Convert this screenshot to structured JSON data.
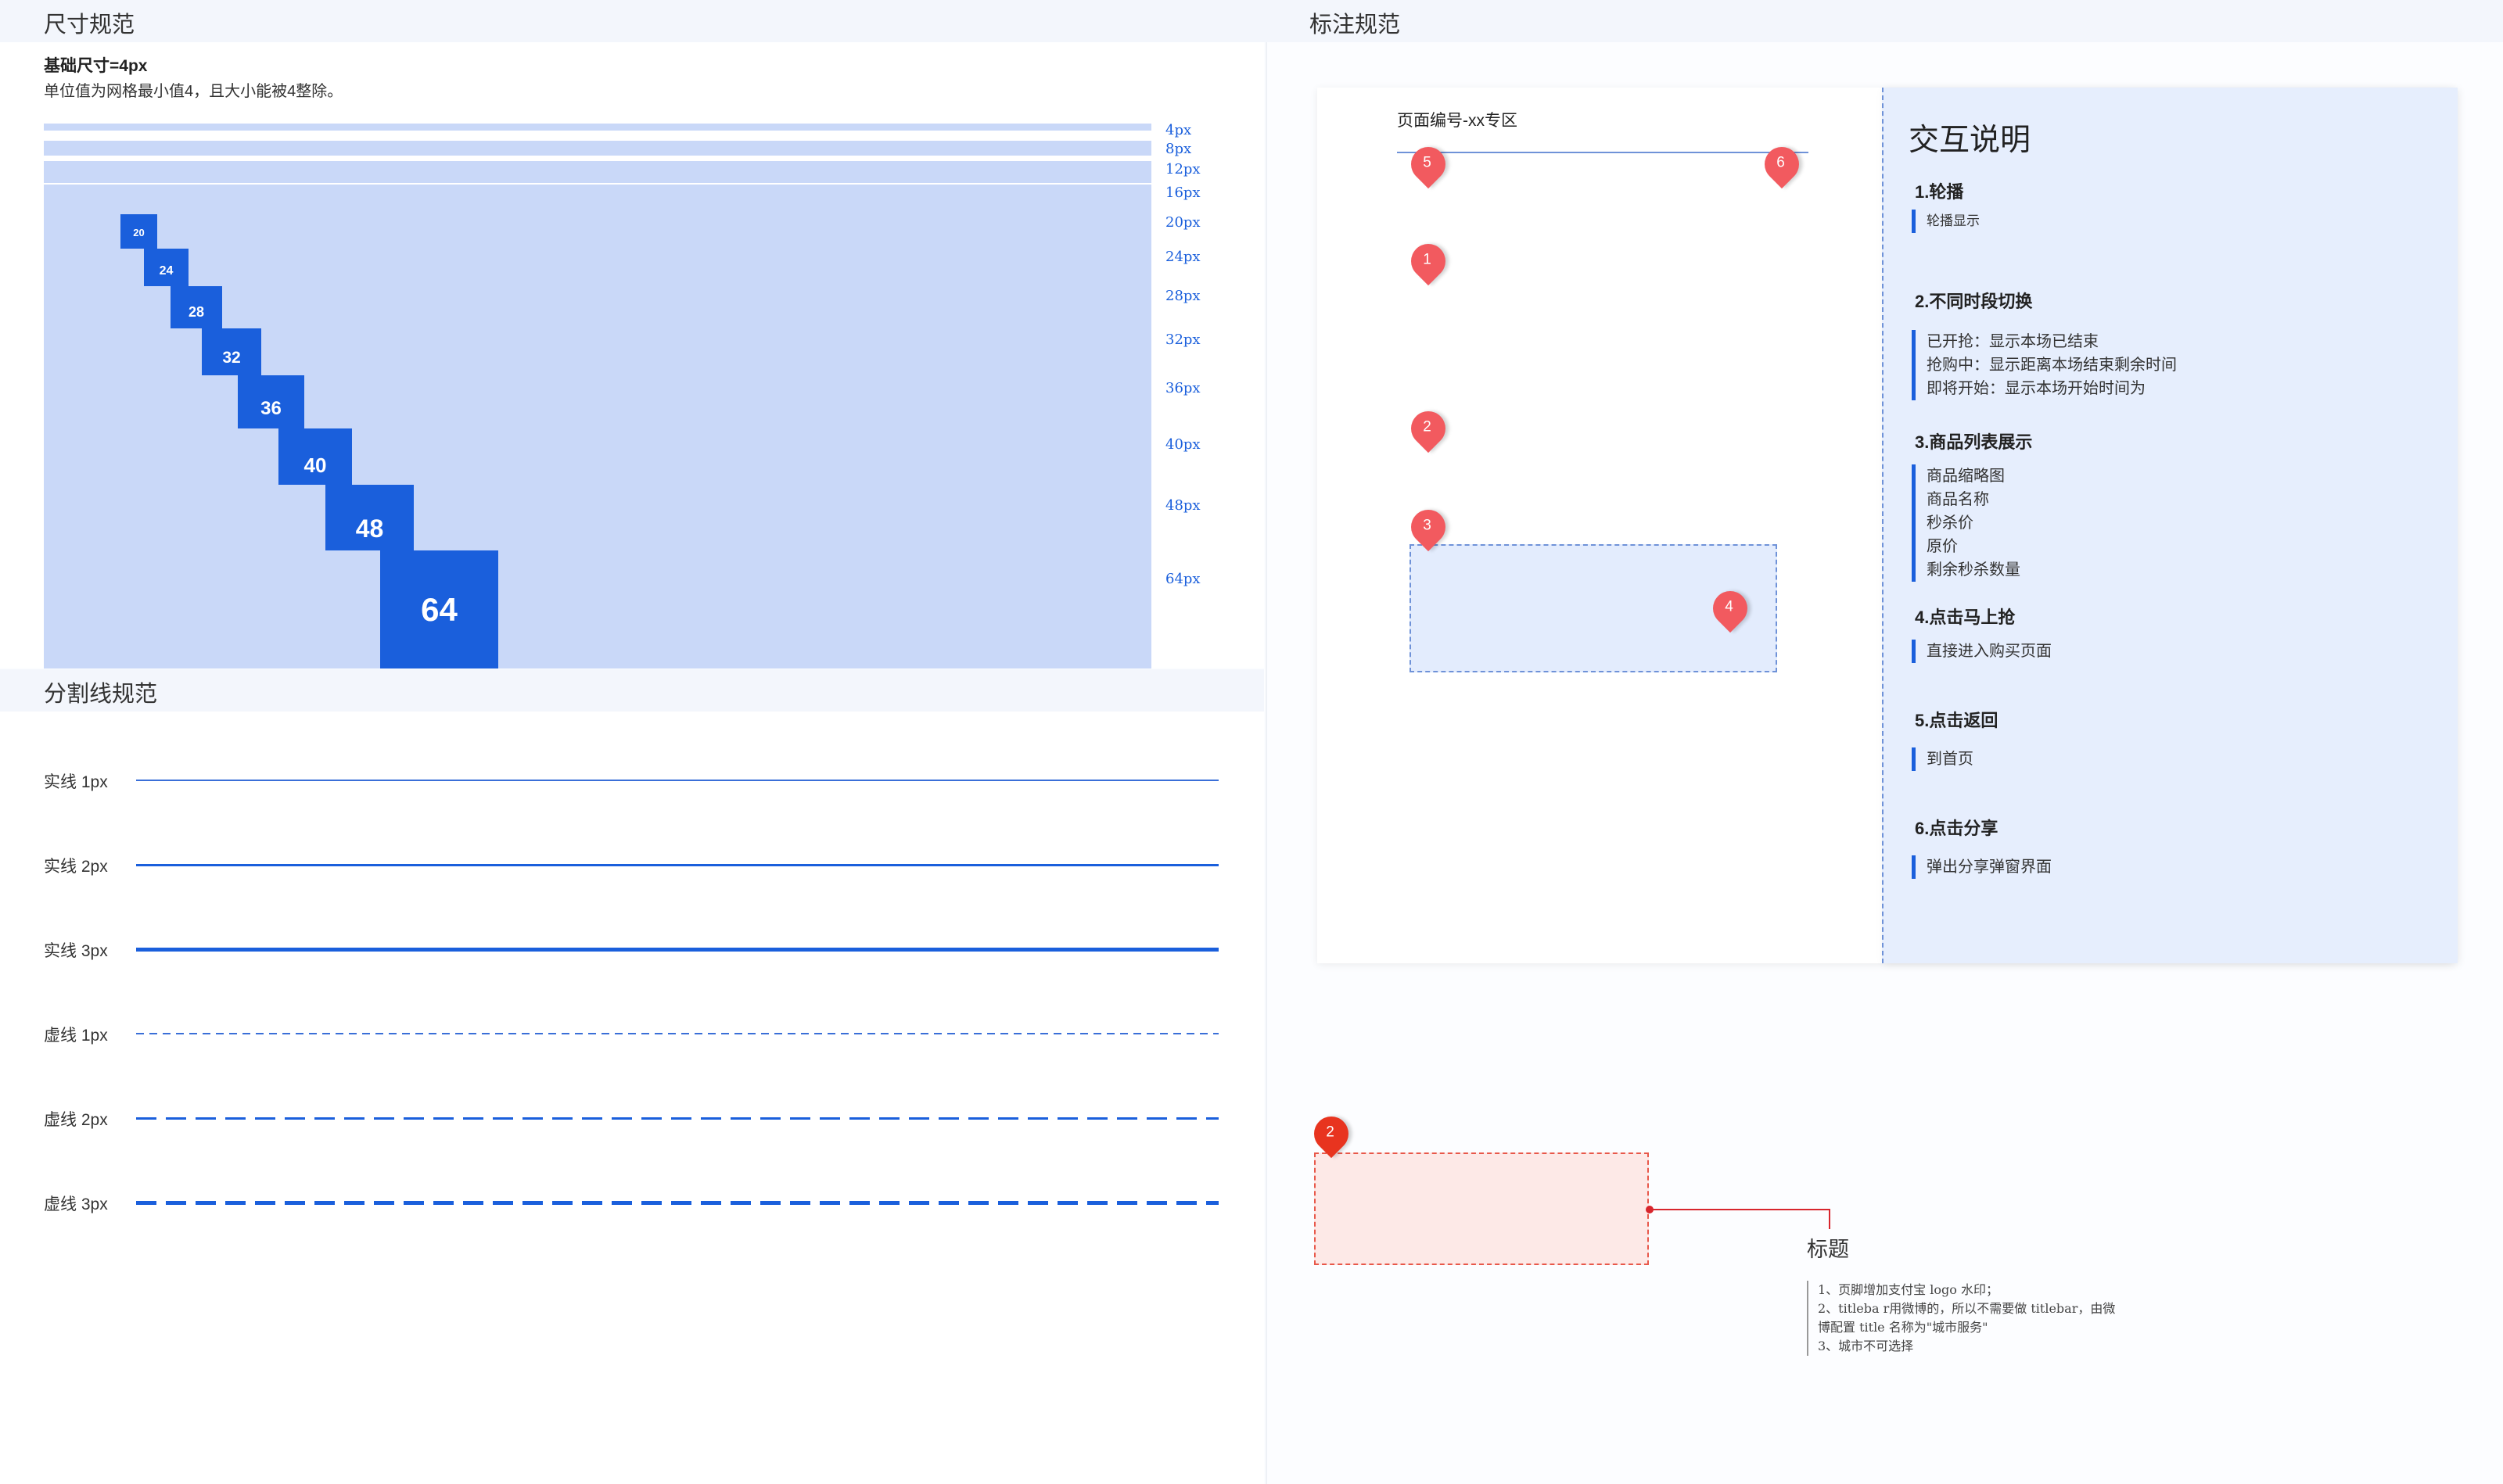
{
  "size_spec": {
    "title": "尺寸规范",
    "base_title": "基础尺寸=4px",
    "description": "单位值为网格最小值4，且大小能被4整除。",
    "rows": [
      {
        "size": 4,
        "label": "4px",
        "badge": ""
      },
      {
        "size": 8,
        "label": "8px",
        "badge": ""
      },
      {
        "size": 12,
        "label": "12px",
        "badge": ""
      },
      {
        "size": 16,
        "label": "16px",
        "badge": ""
      },
      {
        "size": 20,
        "label": "20px",
        "badge": "20"
      },
      {
        "size": 24,
        "label": "24px",
        "badge": "24"
      },
      {
        "size": 28,
        "label": "28px",
        "badge": "28"
      },
      {
        "size": 32,
        "label": "32px",
        "badge": "32"
      },
      {
        "size": 36,
        "label": "36px",
        "badge": "36"
      },
      {
        "size": 40,
        "label": "40px",
        "badge": "40"
      },
      {
        "size": 48,
        "label": "48px",
        "badge": "48"
      },
      {
        "size": 64,
        "label": "64px",
        "badge": "64"
      }
    ]
  },
  "divider_spec": {
    "title": "分割线规范",
    "lines": [
      {
        "label": "实线 1px",
        "style": "solid",
        "weight": 1,
        "color": "#3a6fd8"
      },
      {
        "label": "实线 2px",
        "style": "solid",
        "weight": 2,
        "color": "#1a5fdc"
      },
      {
        "label": "实线 3px",
        "style": "solid",
        "weight": 3,
        "color": "#1a5fdc"
      },
      {
        "label": "虚线 1px",
        "style": "dashed",
        "weight": 1,
        "color": "#3a6fd8"
      },
      {
        "label": "虚线 2px",
        "style": "dashed",
        "weight": 2,
        "color": "#1a5fdc"
      },
      {
        "label": "虚线 3px",
        "style": "dashed",
        "weight": 3,
        "color": "#1a5fdc"
      }
    ]
  },
  "annotation_spec": {
    "title": "标注规范",
    "page_label": "页面编号-xx专区",
    "pins": {
      "p1": "1",
      "p2": "2",
      "p3": "3",
      "p4": "4",
      "p5": "5",
      "p6": "6",
      "p_bottom": "2"
    },
    "interaction": {
      "title": "交互说明",
      "items": [
        {
          "heading": "1.轮播",
          "lines": [
            "轮播显示"
          ]
        },
        {
          "heading": "2.不同时段切换",
          "lines": [
            "已开抢：显示本场已结束",
            "抢购中：显示距离本场结束剩余时间",
            "即将开始：显示本场开始时间为"
          ]
        },
        {
          "heading": "3.商品列表展示",
          "lines": [
            "商品缩略图",
            "商品名称",
            "秒杀价",
            "原价",
            "剩余秒杀数量"
          ]
        },
        {
          "heading": "4.点击马上抢",
          "lines": [
            "直接进入购买页面"
          ]
        },
        {
          "heading": "5.点击返回",
          "lines": [
            "到首页"
          ]
        },
        {
          "heading": "6.点击分享",
          "lines": [
            "弹出分享弹窗界面"
          ]
        }
      ]
    },
    "callout": {
      "title": "标题",
      "notes": [
        "1、页脚增加支付宝 logo 水印；",
        "2、titleba r用微博的，所以不需要做 titlebar，由微",
        "博配置 title 名称为\"城市服务\"",
        "3、城市不可选择"
      ]
    }
  },
  "colors": {
    "accent": "#1a5fdc",
    "bar_fill": "#c9d8f8",
    "pin_red": "#f25a5f",
    "pin_dark_red": "#e8341f",
    "panel_blue": "#e6eefd"
  }
}
